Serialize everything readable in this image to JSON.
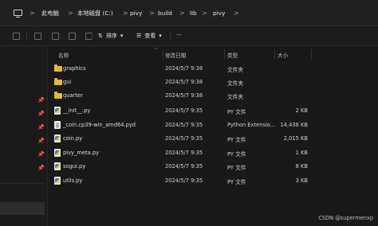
{
  "breadcrumb": {
    "items": [
      "此电脑",
      "本地磁盘 (C:)",
      "pivy",
      "build",
      "lib",
      "pivy"
    ],
    "separator": ">"
  },
  "toolbar": {
    "sort_label": "排序",
    "view_label": "查看",
    "more_label": "···"
  },
  "columns": {
    "name": "名称",
    "modified": "修改日期",
    "type": "类型",
    "size": "大小",
    "sort_indicator": "^"
  },
  "files": [
    {
      "name": "graphics",
      "modified": "2024/5/7 9:38",
      "type": "文件夹",
      "size": "",
      "icon": "folder-icon"
    },
    {
      "name": "gui",
      "modified": "2024/5/7 9:38",
      "type": "文件夹",
      "size": "",
      "icon": "folder-icon"
    },
    {
      "name": "quarter",
      "modified": "2024/5/7 9:38",
      "type": "文件夹",
      "size": "",
      "icon": "folder-icon"
    },
    {
      "name": "__init__.py",
      "modified": "2024/5/7 9:35",
      "type": "PY 文件",
      "size": "2 KB",
      "icon": "python-file-icon"
    },
    {
      "name": "_coin.cp39-win_amd64.pyd",
      "modified": "2024/5/7 9:35",
      "type": "Python Extensio...",
      "size": "14,438 KB",
      "icon": "pyd-file-icon"
    },
    {
      "name": "coin.py",
      "modified": "2024/5/7 9:35",
      "type": "PY 文件",
      "size": "2,015 KB",
      "icon": "python-file-icon"
    },
    {
      "name": "pivy_meta.py",
      "modified": "2024/5/7 9:35",
      "type": "PY 文件",
      "size": "1 KB",
      "icon": "python-file-icon"
    },
    {
      "name": "sogui.py",
      "modified": "2024/5/7 9:35",
      "type": "PY 文件",
      "size": "8 KB",
      "icon": "python-file-icon"
    },
    {
      "name": "utils.py",
      "modified": "2024/5/7 9:35",
      "type": "PY 文件",
      "size": "3 KB",
      "icon": "python-file-icon"
    }
  ],
  "watermark": "CSDN @supermenxp",
  "colors": {
    "background": "#191919",
    "folder": "#e8b83a",
    "text": "#dcdcdc"
  }
}
